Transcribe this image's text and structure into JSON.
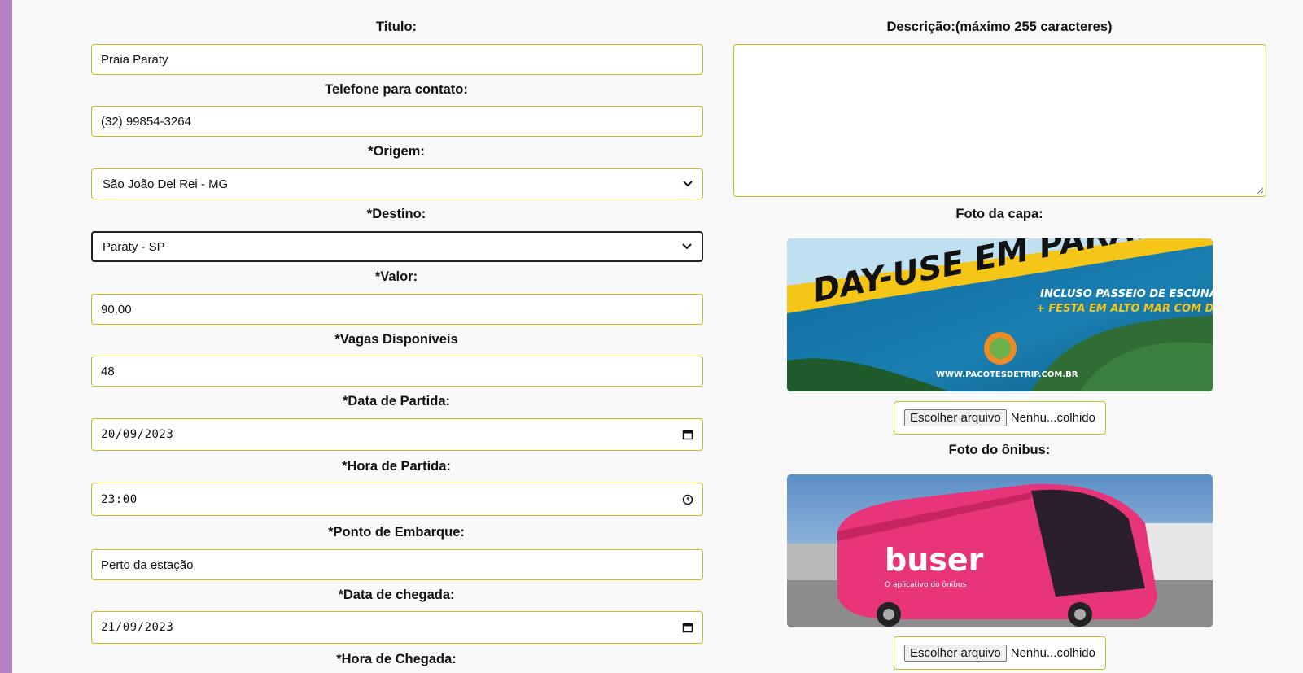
{
  "form": {
    "titulo": {
      "label": "Titulo:",
      "value": "Praia Paraty"
    },
    "telefone": {
      "label": "Telefone para contato:",
      "value": "(32) 99854-3264"
    },
    "origem": {
      "label": "*Origem:",
      "value": "São João Del Rei - MG"
    },
    "destino": {
      "label": "*Destino:",
      "value": "Paraty - SP"
    },
    "valor": {
      "label": "*Valor:",
      "value": "90,00"
    },
    "vagas": {
      "label": "*Vagas Disponíveis",
      "value": "48"
    },
    "data_partida": {
      "label": "*Data de Partida:",
      "value": "20/09/2023"
    },
    "hora_partida": {
      "label": "*Hora de Partida:",
      "value": "23:00"
    },
    "ponto_embarque": {
      "label": "*Ponto de Embarque:",
      "value": "Perto da estação"
    },
    "data_chegada": {
      "label": "*Data de chegada:",
      "value": "21/09/2023"
    },
    "hora_chegada": {
      "label": "*Hora de Chegada:"
    },
    "descricao": {
      "label": "Descrição:(máximo 255 caracteres)",
      "value": ""
    },
    "foto_capa": {
      "label": "Foto da capa:",
      "banner_title": "DAY-USE EM PARATY",
      "banner_line1": "INCLUSO PASSEIO DE ESCUNA",
      "banner_line2": "+ FESTA EM ALTO MAR COM DJ",
      "banner_site": "WWW.PACOTESDETRIP.COM.BR",
      "file_button": "Escolher arquivo",
      "file_status": "Nenhu...colhido"
    },
    "foto_onibus": {
      "label": "Foto do ônibus:",
      "brand": "buser",
      "tagline": "O aplicativo do ônibus",
      "file_button": "Escolher arquivo",
      "file_status": "Nenhu...colhido"
    }
  },
  "colors": {
    "sidebar": "#b57fc0",
    "field_border": "#c1c121",
    "banner_yellow": "#f5c518",
    "bus_pink": "#e8357a"
  }
}
